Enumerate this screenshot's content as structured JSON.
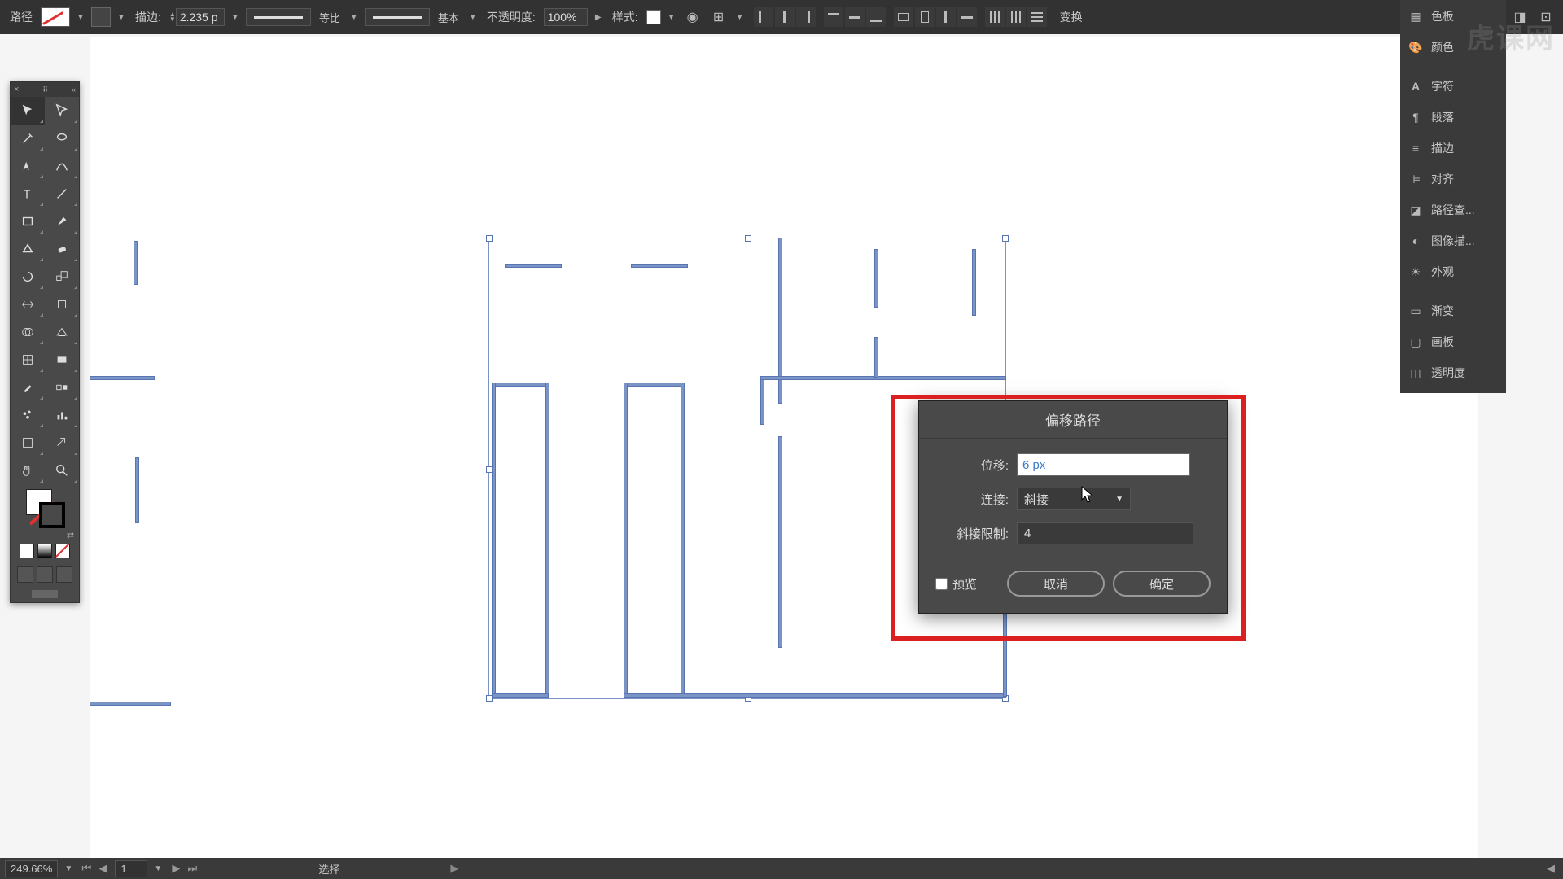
{
  "topbar": {
    "selection_label": "路径",
    "stroke_label": "描边:",
    "stroke_value": "2.235 p",
    "profile_label": "等比",
    "brush_label": "基本",
    "opacity_label": "不透明度:",
    "opacity_value": "100%",
    "style_label": "样式:",
    "transform_label": "变换"
  },
  "right_dock": {
    "items": [
      {
        "label": "色板",
        "icon": "grid"
      },
      {
        "label": "颜色",
        "icon": "palette"
      },
      {
        "label": "字符",
        "icon": "A"
      },
      {
        "label": "段落",
        "icon": "para"
      },
      {
        "label": "描边",
        "icon": "lines"
      },
      {
        "label": "对齐",
        "icon": "align"
      },
      {
        "label": "路径查...",
        "icon": "pathfinder"
      },
      {
        "label": "图像描...",
        "icon": "trace"
      },
      {
        "label": "外观",
        "icon": "sun"
      },
      {
        "label": "渐变",
        "icon": "grad"
      },
      {
        "label": "画板",
        "icon": "artboard"
      },
      {
        "label": "透明度",
        "icon": "trans"
      }
    ]
  },
  "dialog": {
    "title": "偏移路径",
    "offset_label": "位移:",
    "offset_value": "6 px",
    "join_label": "连接:",
    "join_value": "斜接",
    "miter_label": "斜接限制:",
    "miter_value": "4",
    "preview_label": "预览",
    "cancel": "取消",
    "ok": "确定"
  },
  "status": {
    "zoom": "249.66%",
    "artboard": "1",
    "tool_hint": "选择"
  },
  "watermark": "虎课网"
}
